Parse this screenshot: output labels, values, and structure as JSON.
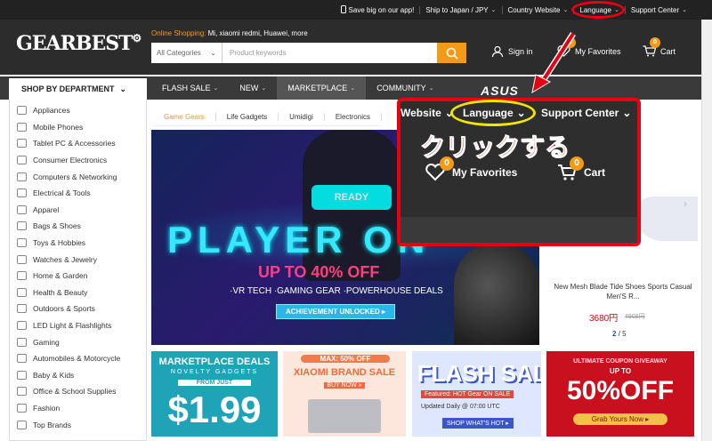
{
  "topbar": {
    "links": [
      {
        "label": "Save big on our app!",
        "icon": "phone-icon"
      },
      {
        "label": "Ship to Japan / JPY"
      },
      {
        "label": "Country Website"
      },
      {
        "label": "Language"
      },
      {
        "label": "Support Center"
      }
    ]
  },
  "header": {
    "logo": "GEARBEST",
    "online_label": "Online Shopping:",
    "online_links": "Mi,  xiaomi redmi,  Huawei,  more",
    "search_category": "All Categories",
    "search_placeholder": "Product keywords",
    "sign_in": "Sign in",
    "favorites": "My Favorites",
    "favorites_count": "0",
    "cart": "Cart",
    "cart_count": "0"
  },
  "nav": {
    "department": "SHOP BY DEPARTMENT",
    "items": [
      "FLASH SALE",
      "NEW",
      "MARKETPLACE",
      "COMMUNITY"
    ],
    "brand_logo": "ASUS"
  },
  "sidebar": {
    "items": [
      "Appliances",
      "Mobile Phones",
      "Tablet PC & Accessories",
      "Consumer Electronics",
      "Computers & Networking",
      "Electrical & Tools",
      "Apparel",
      "Bags & Shoes",
      "Toys & Hobbies",
      "Watches & Jewelry",
      "Home & Garden",
      "Health & Beauty",
      "Outdoors & Sports",
      "LED Light & Flashlights",
      "Gaming",
      "Automobiles & Motorcycle",
      "Baby & Kids",
      "Office & School Supplies",
      "Fashion",
      "Top Brands"
    ]
  },
  "tabs": [
    "Game Gears",
    "Life Gadgets",
    "Umidigi",
    "Electronics"
  ],
  "banner": {
    "visor_text": "READY",
    "headline": "PLAYER ON",
    "sale": "UP TO 40% OFF",
    "features": "·VR TECH  ·GAMING GEAR  ·POWERHOUSE DEALS",
    "cta": "ACHIEVEMENT UNLOCKED ▸"
  },
  "product": {
    "name": "New Mesh Blade Tide Shoes Sports Casual Men'S R...",
    "price": "3680円",
    "old_price": "4908円",
    "page_current": "2",
    "page_total": "/ 5"
  },
  "promos": {
    "t1_title": "MARKETPLACE DEALS",
    "t1_sub": "NOVELTY GADGETS",
    "t1_from": "FROM JUST",
    "t1_price": "$1.99",
    "t2_top": "MAX: 50% OFF",
    "t2_title": "XIAOMI BRAND SALE",
    "t2_btn": "BUY NOW »",
    "t3_title": "FLASH SALE",
    "t3_feat": "Featured: HOT Gear ON SALE",
    "t3_upd": "Updated Daily @ 07:00 UTC",
    "t3_btn": "SHOP WHAT'S HOT ▸",
    "t4_top": "ULTIMATE COUPON GIVEAWAY",
    "t4_upto": "UP TO",
    "t4_big": "50%OFF",
    "t4_btn": "Grab Yours Now ▸"
  },
  "popup": {
    "items": [
      "Website",
      "Language",
      "Support Center"
    ],
    "instruction": "クリックする",
    "favorites": "My Favorites",
    "favorites_count": "0",
    "cart": "Cart",
    "cart_count": "0"
  },
  "colors": {
    "accent": "#f39a18",
    "annotation": "#e60012",
    "highlight": "#f5e400"
  }
}
